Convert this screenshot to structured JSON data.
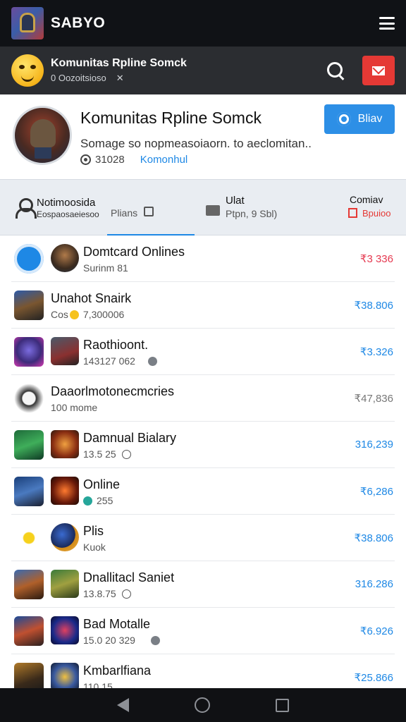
{
  "app": {
    "title": "SABYO"
  },
  "sub_header": {
    "title": "Komunitas Rpline Somck",
    "meta": "0 Oozoitsioso",
    "meta_mark": "✕"
  },
  "profile": {
    "title": "Komunitas Rpline Somck",
    "description": "Somage so nopmeasoiaorn. to aeclomitan..",
    "stat": "31028",
    "link": "Komonhul",
    "button_label": "Bliav"
  },
  "tabs": [
    {
      "line1": "Notimoosida",
      "line2": "Eospaosaeiesoo"
    },
    {
      "label": "Plians"
    },
    {
      "line1": "Ulat",
      "line2": "Ptpn, 9 Sbl)"
    },
    {
      "line1": "Comiav",
      "line2": "Bpuioo"
    }
  ],
  "list": [
    {
      "title": "Domtcard Onlines",
      "sub": "Surinm 81",
      "value": "₹3 336",
      "color": "red",
      "icons": [
        "i-shield",
        "i-warrior"
      ]
    },
    {
      "title": "Unahot Snairk",
      "sub": "Cos",
      "sub2": "7,300006",
      "value": "₹38.806",
      "color": "blue",
      "icons": [
        "i-knight"
      ]
    },
    {
      "title": "Raothioont.",
      "sub": "143127 062",
      "value": "₹3.326",
      "color": "blue",
      "icons": [
        "i-alien",
        "i-robot"
      ]
    },
    {
      "title": "Daaorlmotonecmcries",
      "sub": "100 mome",
      "value": "₹47,836",
      "color": "gray",
      "icons": [
        "i-mask"
      ]
    },
    {
      "title": "Damnual Bialary",
      "sub": "13.5 25",
      "value": "316,239",
      "color": "blue",
      "icons": [
        "i-green",
        "i-fire"
      ]
    },
    {
      "title": "Online",
      "sub": "255",
      "value": "₹6,286",
      "color": "blue",
      "icons": [
        "i-mage",
        "i-lava"
      ]
    },
    {
      "title": "Plis",
      "sub": "Kuok",
      "value": "₹38.806",
      "color": "blue",
      "icons": [
        "i-star",
        "i-orb"
      ]
    },
    {
      "title": "Dnallitacl Saniet",
      "sub": "13.8.75",
      "value": "316.286",
      "color": "blue",
      "icons": [
        "i-archer",
        "i-ranger"
      ]
    },
    {
      "title": "Bad Motalle",
      "sub": "15.0 20 329",
      "value": "₹6.926",
      "color": "blue",
      "icons": [
        "i-brawler",
        "i-void"
      ]
    },
    {
      "title": "Kmbarlfiana",
      "sub": "110.15",
      "value": "₹25.866",
      "color": "blue",
      "icons": [
        "i-gold",
        "i-ice"
      ]
    }
  ]
}
